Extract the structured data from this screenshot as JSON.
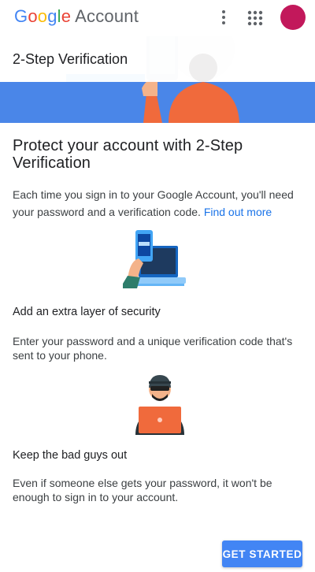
{
  "header": {
    "logo_google_letters": [
      "G",
      "o",
      "o",
      "g",
      "l",
      "e"
    ],
    "logo_product": "Account",
    "menu_icon": "more-vert-icon",
    "apps_icon": "apps-grid-icon",
    "avatar_color": "#c2185b"
  },
  "hero": {
    "title": "2-Step Verification",
    "banner_color": "#4a86e8"
  },
  "main": {
    "heading": "Protect your account with 2-Step Verification",
    "intro_text": "Each time you sign in to your Google Account, you'll need your password and a verification code.",
    "intro_link": "Find out more",
    "sections": [
      {
        "title": "Add an extra layer of security",
        "body": "Enter your password and a unique verification code that's sent to your phone."
      },
      {
        "title": "Keep the bad guys out",
        "body": "Even if someone else gets your password, it won't be enough to sign in to your account."
      }
    ]
  },
  "actions": {
    "get_started_label": "GET STARTED",
    "accent_color": "#4285F4"
  }
}
